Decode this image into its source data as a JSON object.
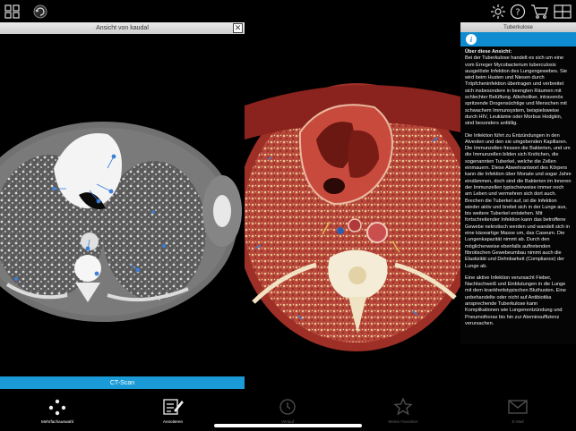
{
  "toolbar": {
    "left_icons": [
      "grid-menu-icon",
      "rotate-icon"
    ],
    "right_icons": [
      "gear-icon",
      "help-icon",
      "cart-icon",
      "layout-icon"
    ]
  },
  "ct_panel": {
    "header_title": "Ansicht von kaudal",
    "close_label": "✕",
    "footer_label": "CT-Scan"
  },
  "info_panel": {
    "title": "Tuberkulose",
    "info_tab_label": "i",
    "paragraphs": [
      "Über diese Ansicht:",
      "Bei der Tuberkulose handelt es sich um eine vom Erreger Mycobacterium tuberculosis ausgelöste Infektion des Lungengewebes. Sie wird beim Husten und Niesen durch Tröpfcheninfektion übertragen und verbreitet sich insbesondere in beengten Räumen mit schlechter Belüftung. Alkoholiker, intravenös spritzende Drogensüchtige und Menschen mit schwachem Immunsystem, beispielsweise durch HIV, Leukämie oder Morbus Hodgkin, sind besonders anfällig.",
      "Die Infektion führt zu Entzündungen in den Alveolen und den sie umgebenden Kapillaren. Die Immunzellen fressen die Bakterien, und um die Immunzellen bilden sich Knötchen, die sogenannten Tuberkel, welche die Zellen einmauern. Diese Abwehrantwort des Körpers kann die Infektion über Monate und sogar Jahre eindämmen, doch sind die Bakterien im Inneren der Immunzellen typischerweise immer noch am Leben und vermehren sich dort auch. Brechen die Tuberkel auf, ist die Infektion wieder aktiv und breitet sich in der Lunge aus, bis weitere Tuberkel entstehen. Mit fortschreitender Infektion kann das betroffene Gewebe nekrotisch werden und wandelt sich in eine käseartige Masse um, das Caseum. Die Lungenkapazität nimmt ab. Durch den möglicherweise ebenfalls auftretenden fibrotischen Gewebeumbau nimmt auch die Elastizität und Dehnbarkeit (Compliance) der Lunge ab.",
      "Eine aktive Infektion verursacht Fieber, Nachtschweiß und Einblutungen in die Lunge mit dem krankheitstypischen Bluthusten. Eine unbehandelte oder nicht auf Antibiotika ansprechende Tuberkulose kann Komplikationen wie Lungenentzündung und Pneumothorax bis hin zur Ateminsuffizienz verursachen."
    ]
  },
  "bottom_tabs": [
    {
      "label": "Mehrfachauswahl",
      "icon": "multi-select-icon"
    },
    {
      "label": "Annotieren",
      "icon": "annotate-icon"
    },
    {
      "label": "Verlauf",
      "icon": "history-icon"
    },
    {
      "label": "Meine Favoriten",
      "icon": "favorites-icon"
    },
    {
      "label": "E-Mail",
      "icon": "email-icon"
    }
  ],
  "colors": {
    "accent": "#1a9bd7",
    "info_tab": "#0f8ccf",
    "background": "#000000"
  }
}
